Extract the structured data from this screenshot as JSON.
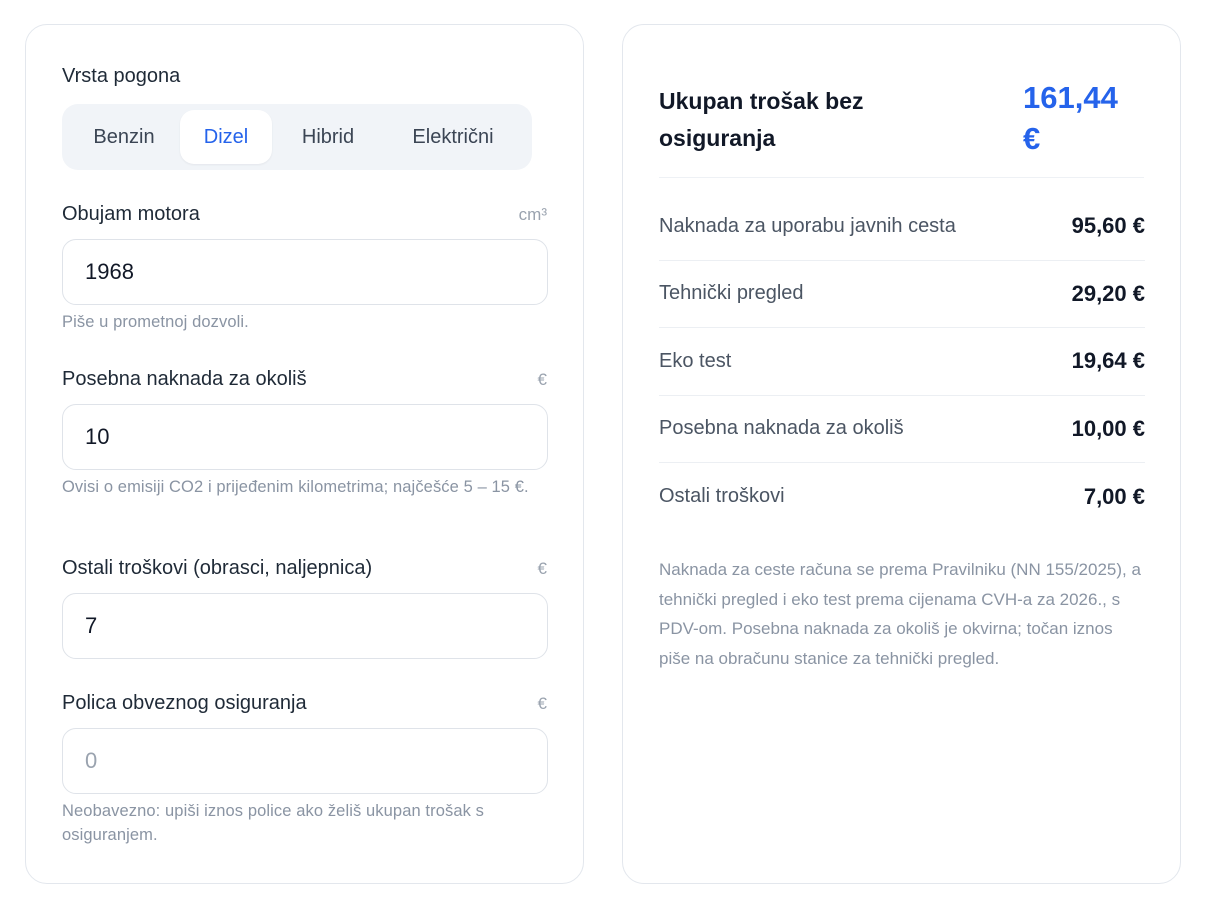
{
  "form": {
    "drive_type": {
      "label": "Vrsta pogona",
      "options": [
        "Benzin",
        "Dizel",
        "Hibrid",
        "Električni"
      ],
      "selected": "Dizel"
    },
    "engine_volume": {
      "label": "Obujam motora",
      "unit": "cm³",
      "value": "1968",
      "hint": "Piše u prometnoj dozvoli."
    },
    "environment_fee": {
      "label": "Posebna naknada za okoliš",
      "unit": "€",
      "value": "10",
      "hint": "Ovisi o emisiji CO2 i prijeđenim kilometrima; najčešće 5 – 15 €."
    },
    "other_costs": {
      "label": "Ostali troškovi (obrasci, naljepnica)",
      "unit": "€",
      "value": "7"
    },
    "insurance": {
      "label": "Polica obveznog osiguranja",
      "unit": "€",
      "value": "",
      "placeholder": "0",
      "hint": "Neobavezno: upiši iznos police ako želiš ukupan trošak s osiguranjem."
    }
  },
  "summary": {
    "total_label": "Ukupan trošak bez osiguranja",
    "total_value": "161,44 €",
    "rows": [
      {
        "label": "Naknada za uporabu javnih cesta",
        "value": "95,60 €"
      },
      {
        "label": "Tehnički pregled",
        "value": "29,20 €"
      },
      {
        "label": "Eko test",
        "value": "19,64 €"
      },
      {
        "label": "Posebna naknada za okoliš",
        "value": "10,00 €"
      },
      {
        "label": "Ostali troškovi",
        "value": "7,00 €"
      }
    ],
    "note": "Naknada za ceste računa se prema Pravilniku (NN 155/2025), a tehnički pregled i eko test prema cijenama CVH-a za 2026., s PDV-om. Posebna naknada za okoliš je okvirna; točan iznos piše na obračunu stanice za tehnički pregled."
  },
  "colors": {
    "accent": "#2563eb",
    "border": "#e3e7ed",
    "muted": "#8a94a3",
    "segment_bg": "#f1f4f8"
  }
}
